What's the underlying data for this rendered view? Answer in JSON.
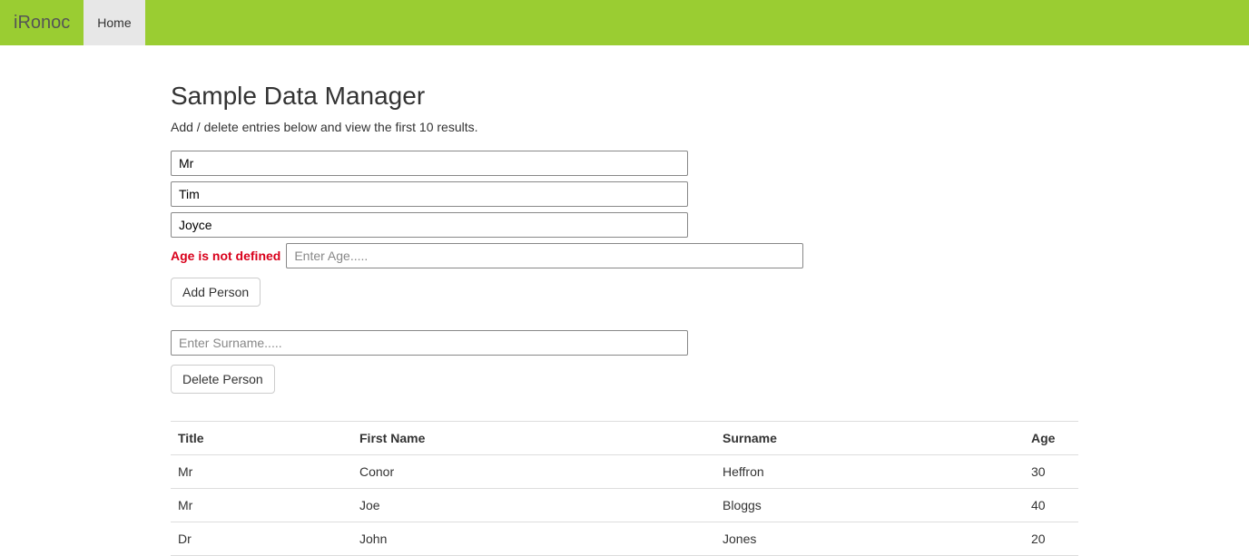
{
  "navbar": {
    "brand": "iRonoc",
    "home": "Home"
  },
  "page": {
    "title": "Sample Data Manager",
    "subtitle": "Add / delete entries below and view the first 10 results."
  },
  "form": {
    "title_val": "Mr",
    "firstname_val": "Tim",
    "surname_val": "Joyce",
    "age_error": "Age is not defined",
    "age_placeholder": "Enter Age.....",
    "add_button": "Add Person",
    "delete_surname_placeholder": "Enter Surname.....",
    "delete_button": "Delete Person"
  },
  "table": {
    "headers": {
      "title": "Title",
      "first_name": "First Name",
      "surname": "Surname",
      "age": "Age"
    },
    "rows": [
      {
        "title": "Mr",
        "first_name": "Conor",
        "surname": "Heffron",
        "age": "30"
      },
      {
        "title": "Mr",
        "first_name": "Joe",
        "surname": "Bloggs",
        "age": "40"
      },
      {
        "title": "Dr",
        "first_name": "John",
        "surname": "Jones",
        "age": "20"
      }
    ]
  }
}
